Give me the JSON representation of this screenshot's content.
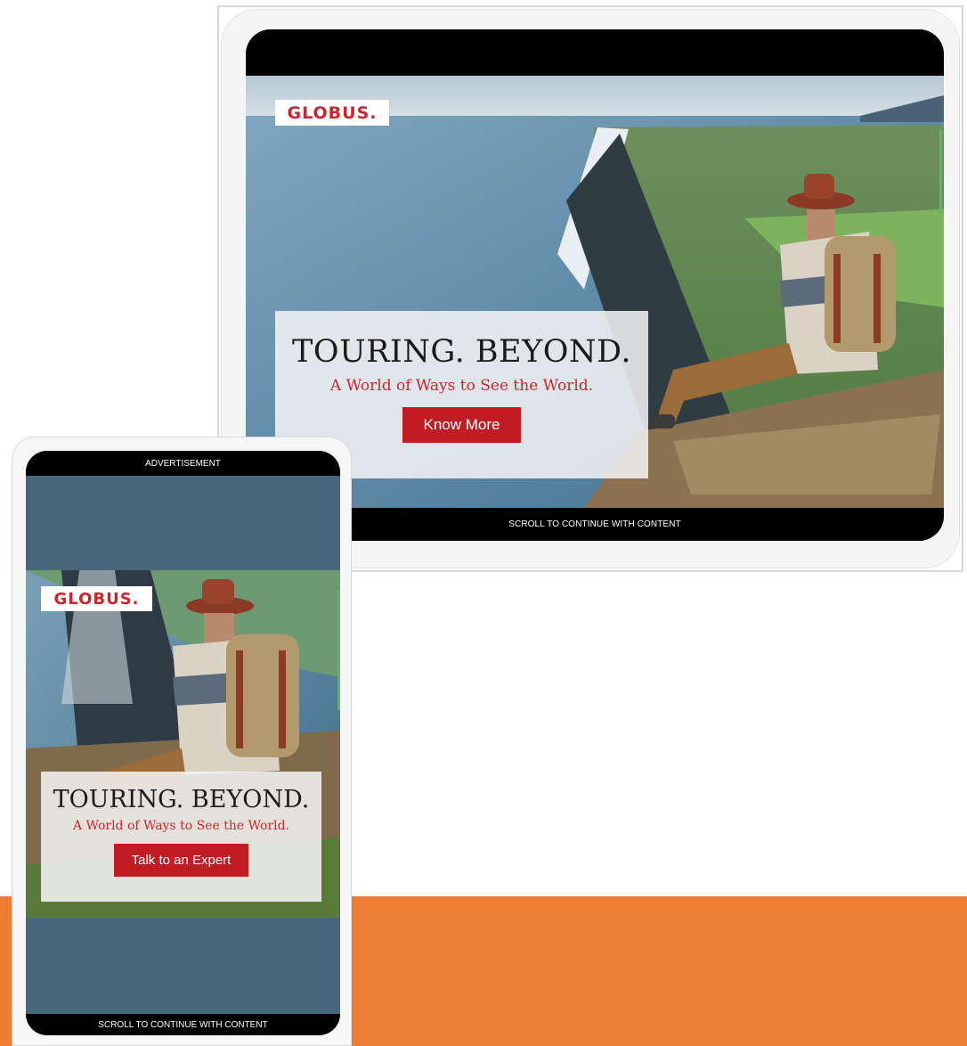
{
  "tablet": {
    "logo": "GLOBUS.",
    "headline": "TOURING. BEYOND.",
    "subheadline": "A World of Ways to See the World.",
    "cta_label": "Know More",
    "footer_label": "SCROLL TO CONTINUE WITH CONTENT"
  },
  "phone": {
    "top_label": "ADVERTISEMENT",
    "logo": "GLOBUS.",
    "headline": "TOURING. BEYOND.",
    "subheadline": "A World of Ways to See the World.",
    "cta_label": "Talk to an Expert",
    "footer_label": "SCROLL TO CONTINUE WITH CONTENT"
  },
  "colors": {
    "brand_red": "#c21b23",
    "background_band": "#ec7d32",
    "phone_screen_bg": "#47687c",
    "scroll_indicator": "#5cb85c"
  }
}
